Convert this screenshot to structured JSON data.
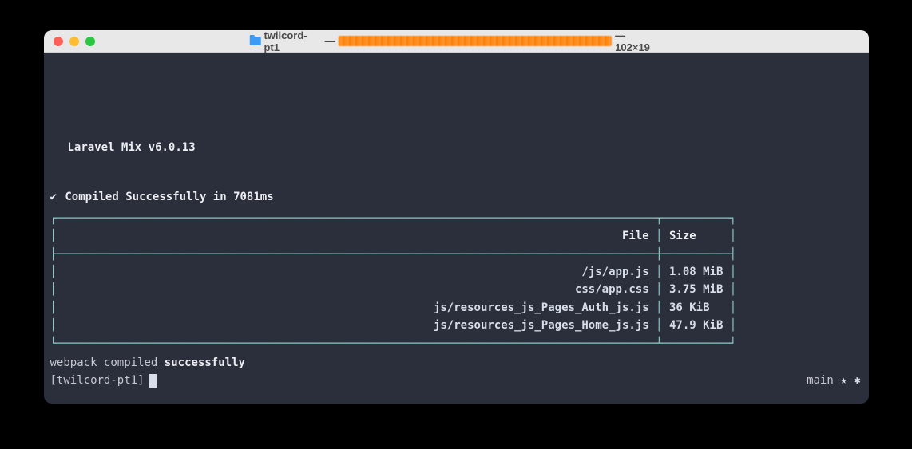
{
  "window": {
    "title_folder": "twilcord-pt1",
    "title_sep": " — ",
    "title_dims": " — 102×19"
  },
  "mix": {
    "header": "Laravel Mix v6.0.13",
    "compiled_prefix": "✔ ",
    "compiled_text": "Compiled Successfully in 7081ms"
  },
  "table": {
    "headers": {
      "file": "File",
      "size": "Size"
    },
    "rows": [
      {
        "file": "/js/app.js",
        "size": "1.08 MiB"
      },
      {
        "file": "css/app.css",
        "size": "3.75 MiB"
      },
      {
        "file": "js/resources_js_Pages_Auth_js.js",
        "size": "36 KiB"
      },
      {
        "file": "js/resources_js_Pages_Home_js.js",
        "size": "47.9 KiB"
      }
    ]
  },
  "webpack": {
    "prefix": "webpack compiled ",
    "status": "successfully"
  },
  "prompt": {
    "text": "[twilcord-pt1]",
    "branch": "main",
    "symbols": " ★ ✱"
  }
}
